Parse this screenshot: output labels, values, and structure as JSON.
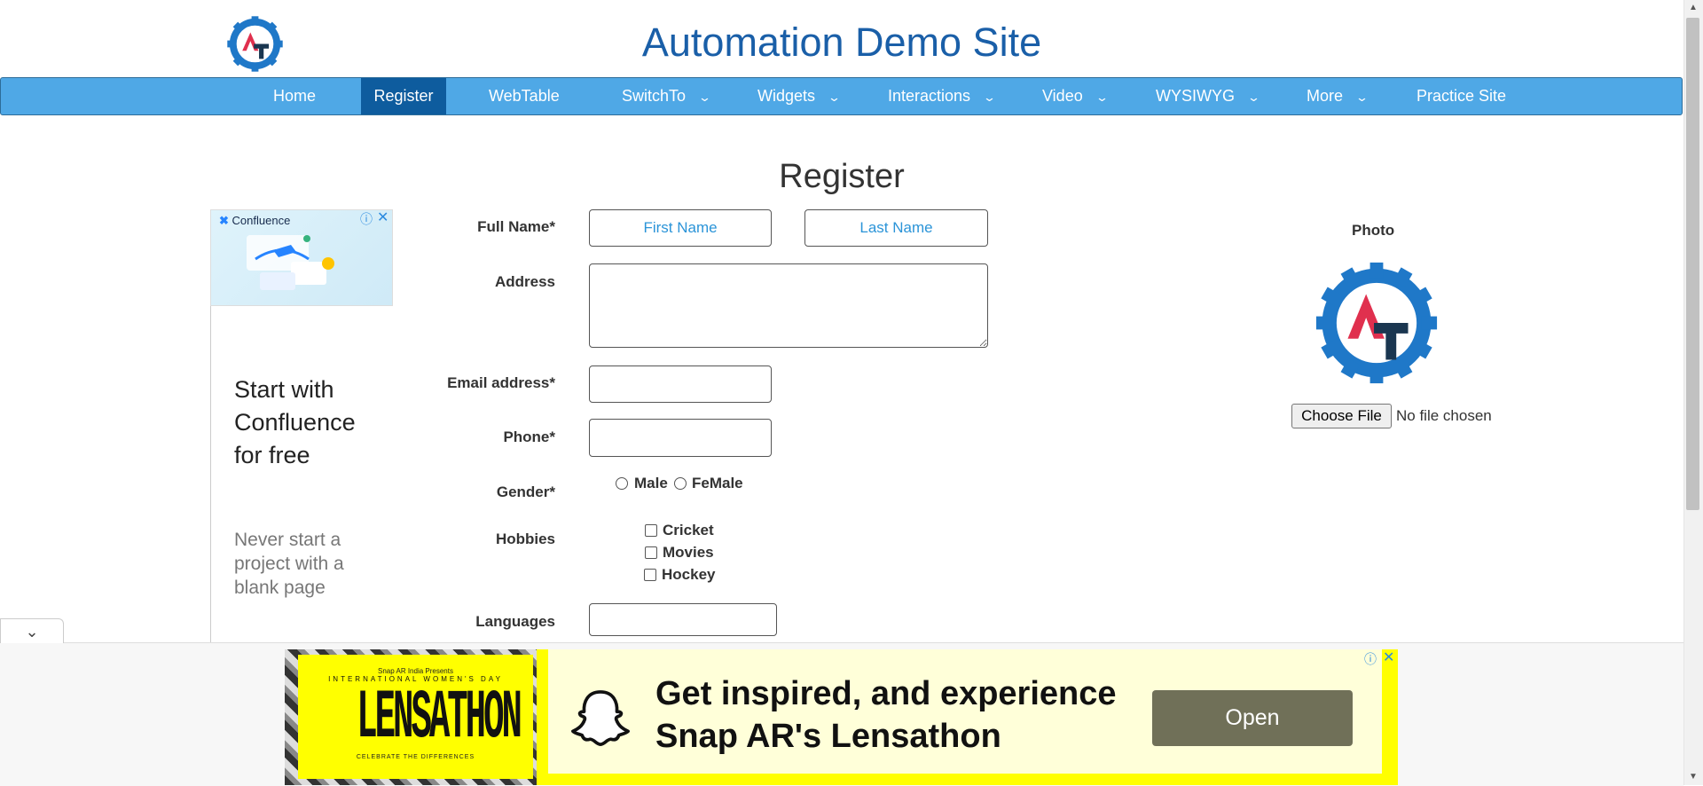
{
  "site": {
    "title": "Automation Demo Site"
  },
  "nav": {
    "items": [
      {
        "label": "Home"
      },
      {
        "label": "Register",
        "active": true
      },
      {
        "label": "WebTable"
      },
      {
        "label": "SwitchTo",
        "dropdown": true
      },
      {
        "label": "Widgets",
        "dropdown": true
      },
      {
        "label": "Interactions",
        "dropdown": true
      },
      {
        "label": "Video",
        "dropdown": true
      },
      {
        "label": "WYSIWYG",
        "dropdown": true
      },
      {
        "label": "More",
        "dropdown": true
      },
      {
        "label": "Practice Site"
      }
    ]
  },
  "form": {
    "heading": "Register",
    "full_name": {
      "label": "Full Name*",
      "first_placeholder": "First Name",
      "last_placeholder": "Last Name"
    },
    "address": {
      "label": "Address"
    },
    "email": {
      "label": "Email address*"
    },
    "phone": {
      "label": "Phone*"
    },
    "gender": {
      "label": "Gender*",
      "options": [
        "Male",
        "FeMale"
      ]
    },
    "hobbies": {
      "label": "Hobbies",
      "options": [
        "Cricket",
        "Movies",
        "Hockey"
      ]
    },
    "languages": {
      "label": "Languages"
    }
  },
  "photo": {
    "label": "Photo",
    "choose_button": "Choose File",
    "status": "No file chosen"
  },
  "left_ad": {
    "brand": "Confluence",
    "headline": "Start with Confluence for free",
    "sub": "Never start a project with a blank page"
  },
  "bottom_ad": {
    "image_top": "Snap AR India Presents",
    "image_small": "INTERNATIONAL WOMEN'S DAY",
    "image_main": "LENSATHON",
    "image_bottom": "CELEBRATE THE DIFFERENCES",
    "text": "Get inspired, and experience Snap AR's Lensathon",
    "button": "Open"
  },
  "colors": {
    "nav_bg": "#4fa8e6",
    "nav_active": "#0e5c9e",
    "title": "#1a5fa8",
    "placeholder": "#2b94d8",
    "ad_yellow": "#ffff00",
    "open_btn": "#707058"
  }
}
